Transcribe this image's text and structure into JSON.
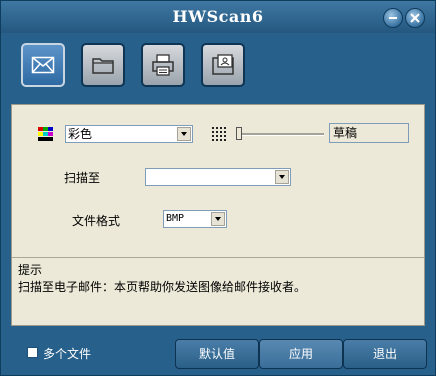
{
  "window": {
    "title": "HWScan6"
  },
  "toolbar": {
    "tools": [
      {
        "icon": "envelope-icon",
        "active": true
      },
      {
        "icon": "folder-icon",
        "active": false
      },
      {
        "icon": "printer-icon",
        "active": false
      },
      {
        "icon": "fax-icon",
        "active": false
      }
    ]
  },
  "settings": {
    "color_mode": "彩色",
    "resolution_value": "草稿",
    "scan_to_label": "扫描至",
    "scan_to_value": "",
    "file_format_label": "文件格式",
    "file_format_value": "BMP"
  },
  "hint": {
    "title": "提示",
    "text": "扫描至电子邮件：本页帮助你发送图像给邮件接收者。"
  },
  "footer": {
    "multi_file_label": "多个文件",
    "default_button": "默认值",
    "apply_button": "应用",
    "exit_button": "退出"
  }
}
